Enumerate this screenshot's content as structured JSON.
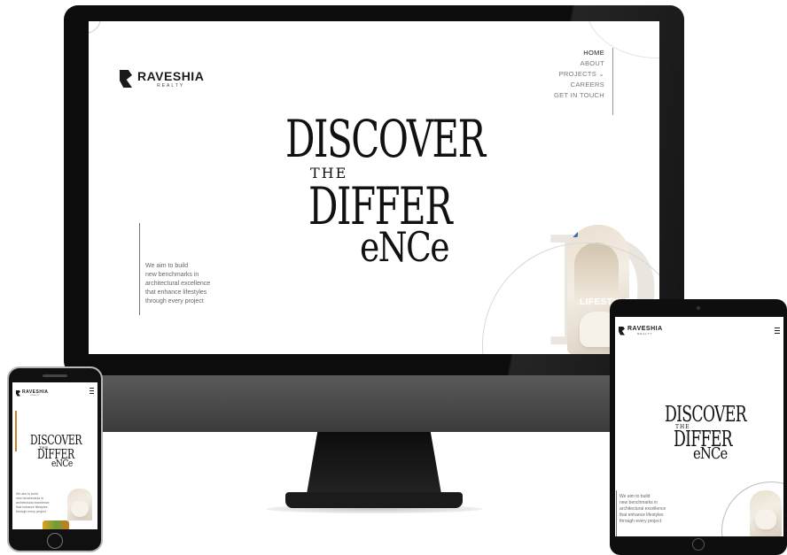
{
  "brand": {
    "name": "RAVESHIA",
    "sub": "REALTY"
  },
  "nav": {
    "items": [
      "HOME",
      "ABOUT",
      "PROJECTS ⌄",
      "CAREERS",
      "GET IN TOUCH"
    ],
    "active_index": 0
  },
  "hero": {
    "line1": "DISCOVER",
    "line2": "THE",
    "line3": "DIFFER",
    "line4": "eNCe"
  },
  "tagline": "We aim to build\nnew benchmarks in\narchitectural excellence\nthat enhance lifestyles\nthrough every project",
  "card": {
    "text": "LIFESTYLE",
    "letter": "D"
  },
  "colors": {
    "bezel": "#0c0c0c",
    "stand": "#3b3b3b",
    "text": "#111111",
    "accent_orange": "#c9812d",
    "badge_blue": "#3c6fb5"
  }
}
